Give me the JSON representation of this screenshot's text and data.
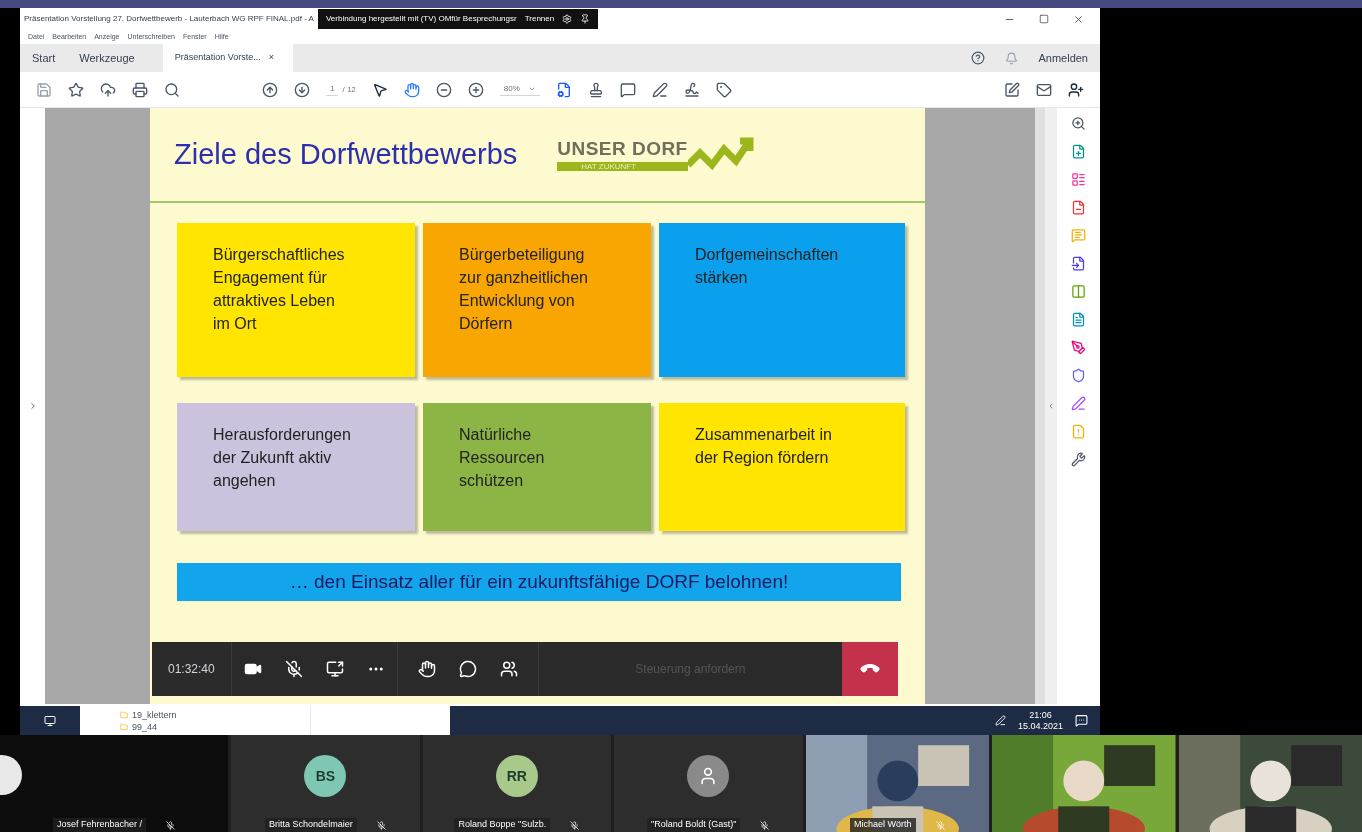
{
  "acrobat": {
    "title": "Präsentation Vorstellung 27. Dorfwettbewerb - Lauterbach WG RPF FINAL.pdf - A",
    "menu": [
      "Datei",
      "Bearbeiten",
      "Anzeige",
      "Unterschreiben",
      "Fenster",
      "Hilfe"
    ],
    "tabs": [
      {
        "label": "Start",
        "selected": false
      },
      {
        "label": "Werkzeuge",
        "selected": false
      },
      {
        "label": "Präsentation Vorste...",
        "selected": true,
        "close": "×"
      }
    ],
    "sign_in": "Anmelden",
    "page_number": "1",
    "page_total": "/ 12",
    "zoom": "80%"
  },
  "teams_banner": {
    "text": "Verbindung hergestellt mit (TV) OMfür Besprechungsr",
    "button": "Trennen"
  },
  "slide": {
    "title": "Ziele des Dorfwettbewerbs",
    "logo": {
      "line1": "UNSER DORF",
      "line2": "HAT ZUKUNFT"
    },
    "goals": [
      {
        "text": "Bürgerschaftliches\nEngagement für\nattraktives Leben\nim Ort",
        "color": "#ffe500"
      },
      {
        "text": "Bürgerbeteiligung\nzur ganzheitlichen\nEntwicklung von\nDörfern",
        "color": "#f9a602"
      },
      {
        "text": "Dorfgemeinschaften\nstärken",
        "color": "#0ba0ee"
      },
      {
        "text": "Herausforderungen\nder Zukunft aktiv\nangehen",
        "color": "#cbc3dd"
      },
      {
        "text": "Natürliche\nRessourcen\nschützen",
        "color": "#8db545"
      },
      {
        "text": "Zusammenarbeit in\nder Region fördern",
        "color": "#ffe500"
      }
    ],
    "banner": "… den Einsatz aller für ein zukunftsfähige DORF belohnen!"
  },
  "call_bar": {
    "duration": "01:32:40",
    "request_control": "Steuerung anfordern"
  },
  "taskbar": {
    "files": [
      "19_klettern",
      "99_44"
    ],
    "time": "21:06",
    "date": "15.04.2021"
  },
  "participants": [
    {
      "kind": "blank",
      "name": "Josef Fehrenbacher /"
    },
    {
      "kind": "avatar",
      "initials": "BS",
      "name": "Britta Schondelmaier",
      "color": "#7fc6b4"
    },
    {
      "kind": "avatar",
      "initials": "RR",
      "name": "Roland Boppe \"Sulzb.",
      "color": "#a9c98a"
    },
    {
      "kind": "guest",
      "name": "\"Roland Boldt (Gast)\"",
      "color": "#8a8a8a"
    },
    {
      "kind": "video",
      "name": "Michael Wörth"
    },
    {
      "kind": "video"
    },
    {
      "kind": "video"
    }
  ]
}
